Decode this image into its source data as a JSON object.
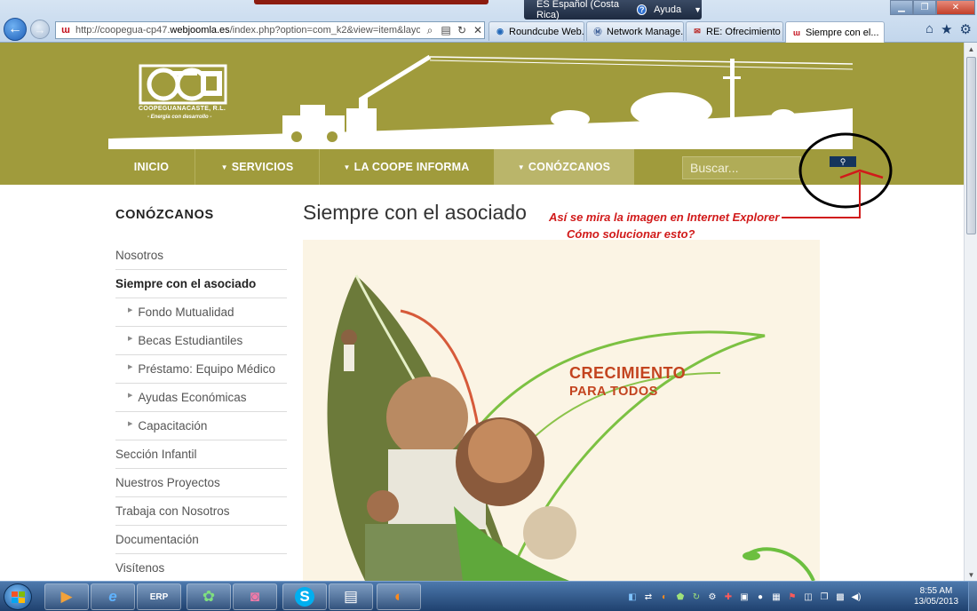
{
  "browser": {
    "url_prefix": "http://coopegua-cp47.",
    "url_domain": "webjoomla.es",
    "url_rest": "/index.php?option=com_k2&view=item&layout=",
    "ime_language": "ES Español (Costa Rica)",
    "ime_help": "Ayuda",
    "tabs": [
      {
        "label": "Roundcube Web...",
        "icon_color": "#1f66b8"
      },
      {
        "label": "Network Manage...",
        "icon_color": "#2a4f8d"
      },
      {
        "label": "RE: Ofrecimiento ...",
        "icon_color": "#b8211f"
      },
      {
        "label": "Siempre con el...",
        "icon_color": "#c4101c"
      }
    ]
  },
  "site": {
    "logo_name": "COOPEGUANACASTE, R.L.",
    "logo_tagline": "- Energía con desarrollo -",
    "menu": [
      "INICIO",
      "SERVICIOS",
      "LA COOPE INFORMA",
      "CONÓZCANOS"
    ],
    "search_placeholder": "Buscar...",
    "sidebar_title": "CONÓZCANOS",
    "sidebar_items": [
      "Nosotros",
      "Siempre con el asociado",
      "Fondo Mutualidad",
      "Becas Estudiantiles",
      "Préstamo: Equipo Médico",
      "Ayudas Económicas",
      "Capacitación",
      "Sección Infantil",
      "Nuestros Proyectos",
      "Trabaja con Nosotros",
      "Documentación",
      "Visítenos"
    ],
    "page_title": "Siempre con el asociado",
    "hero_title_1": "CRECIMIENTO",
    "hero_title_2": "PARA TODOS",
    "theme_color": "#a09b3c"
  },
  "annotation": {
    "line_1": "Así se mira la imagen en Internet Explorer",
    "line_2": "Cómo solucionar esto?",
    "color": "#d11a1a"
  },
  "taskbar": {
    "clock_time": "8:55 AM",
    "clock_date": "13/05/2013",
    "erp_label": "ERP"
  }
}
